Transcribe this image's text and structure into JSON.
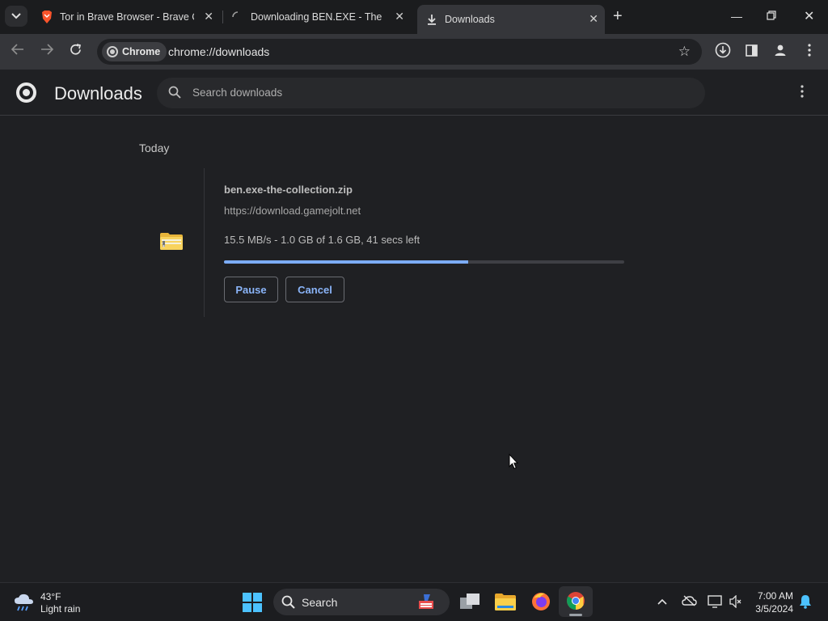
{
  "tabs": [
    {
      "title": "Tor in Brave Browser - Brave Co",
      "icon": "brave-lion-icon"
    },
    {
      "title": "Downloading BEN.EXE - The Co",
      "icon": "loading-spinner-icon"
    },
    {
      "title": "Downloads",
      "icon": "download-arrow-icon",
      "active": true
    }
  ],
  "omnibox": {
    "chip_label": "Chrome",
    "url": "chrome://downloads"
  },
  "page": {
    "title": "Downloads",
    "search_placeholder": "Search downloads"
  },
  "downloads": {
    "group_label": "Today",
    "item": {
      "filename": "ben.exe-the-collection.zip",
      "source_url": "https://download.gamejolt.net",
      "status": "15.5 MB/s - 1.0 GB of 1.6 GB, 41 secs left",
      "progress": 0.61,
      "pause_label": "Pause",
      "cancel_label": "Cancel"
    }
  },
  "taskbar": {
    "weather_temp": "43°F",
    "weather_condition": "Light rain",
    "search_label": "Search",
    "time": "7:00 AM",
    "date": "3/5/2024"
  },
  "colors": {
    "accent": "#8ab4f8",
    "progress_fill": "#7cacf8",
    "background": "#1f2023"
  }
}
